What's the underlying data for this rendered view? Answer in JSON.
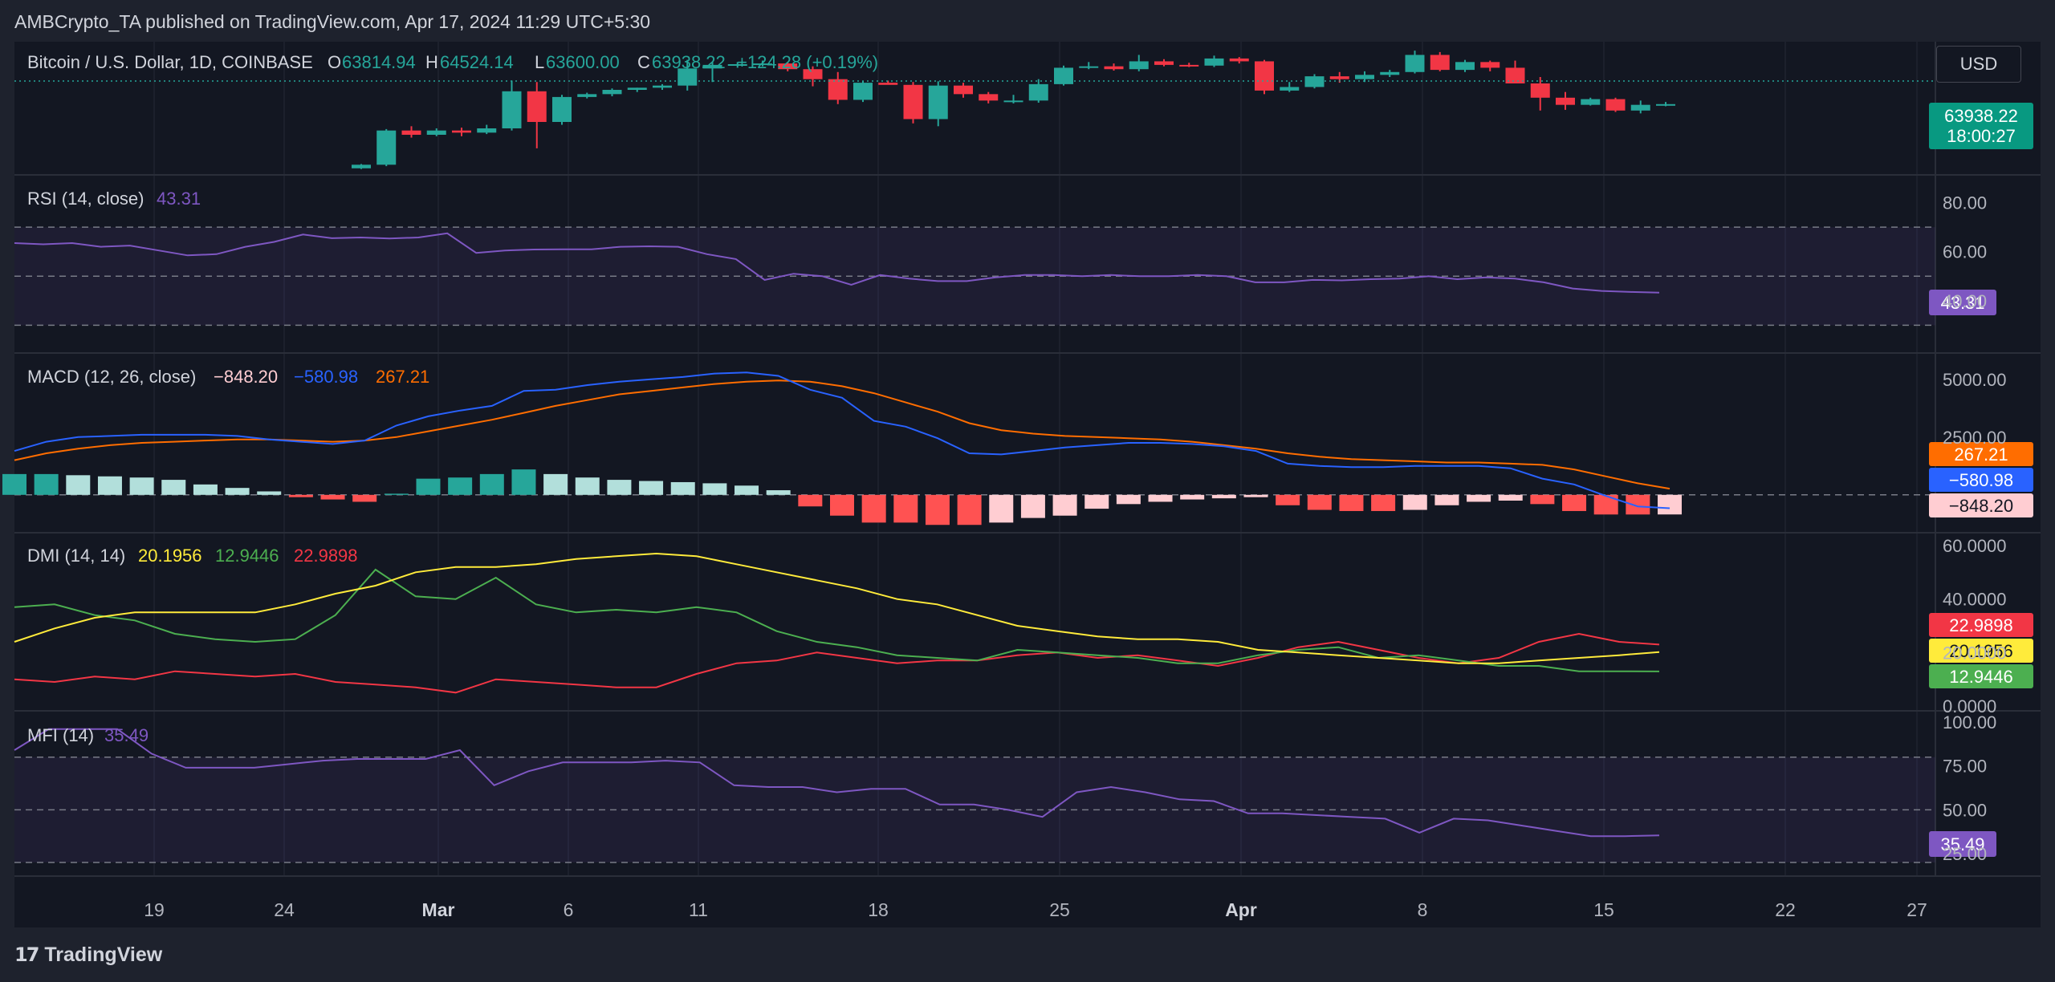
{
  "header": "AMBCrypto_TA published on TradingView.com, Apr 17, 2024 11:29 UTC+5:30",
  "brand": "TradingView",
  "currency": "USD",
  "colors": {
    "bg": "#131722",
    "outer": "#1e222d",
    "up": "#26a69a",
    "down": "#f23645",
    "rsi": "#7e57c2",
    "macd": "#2962ff",
    "signal": "#ff6d00",
    "dmiAdx": "#ffeb3b",
    "dmiPlus": "#4caf50",
    "dmiMinus": "#f23645",
    "mfi": "#7e57c2"
  },
  "chart_data": [
    {
      "type": "candlestick",
      "title": "Bitcoin / U.S. Dollar, 1D, COINBASE",
      "ohlc": {
        "o_label": "O",
        "o": "63814.94",
        "h_label": "H",
        "h": "64524.14",
        "l_label": "L",
        "l": "63600.00",
        "c_label": "C",
        "c": "63938.22",
        "change": "+124.28 (+0.19%)"
      },
      "last_price": "63938.22",
      "countdown": "18:00:27",
      "x_ticks": [
        "19",
        "24",
        "Mar",
        "6",
        "11",
        "18",
        "25",
        "Apr",
        "8",
        "15",
        "22",
        "27"
      ],
      "candles": [
        {
          "o": 51700,
          "h": 52300,
          "l": 51600,
          "c": 52200
        },
        {
          "o": 52200,
          "h": 57200,
          "l": 52000,
          "c": 57000
        },
        {
          "o": 57000,
          "h": 57600,
          "l": 56000,
          "c": 56400
        },
        {
          "o": 56400,
          "h": 57300,
          "l": 56200,
          "c": 57000
        },
        {
          "o": 57000,
          "h": 57400,
          "l": 56200,
          "c": 56700
        },
        {
          "o": 56700,
          "h": 57800,
          "l": 56500,
          "c": 57300
        },
        {
          "o": 57300,
          "h": 64000,
          "l": 57000,
          "c": 62500
        },
        {
          "o": 62500,
          "h": 63800,
          "l": 54500,
          "c": 58200
        },
        {
          "o": 58200,
          "h": 62000,
          "l": 57800,
          "c": 61700
        },
        {
          "o": 61700,
          "h": 62300,
          "l": 61500,
          "c": 62100
        },
        {
          "o": 62100,
          "h": 62900,
          "l": 61800,
          "c": 62700
        },
        {
          "o": 62700,
          "h": 63000,
          "l": 62400,
          "c": 63000
        },
        {
          "o": 63000,
          "h": 63500,
          "l": 62700,
          "c": 63300
        },
        {
          "o": 63300,
          "h": 66900,
          "l": 62600,
          "c": 65700
        },
        {
          "o": 65700,
          "h": 66600,
          "l": 63800,
          "c": 66200
        },
        {
          "o": 66200,
          "h": 66600,
          "l": 65800,
          "c": 66300
        },
        {
          "o": 66300,
          "h": 66800,
          "l": 66000,
          "c": 66400
        },
        {
          "o": 66400,
          "h": 66600,
          "l": 65300,
          "c": 65600
        },
        {
          "o": 65600,
          "h": 66000,
          "l": 63200,
          "c": 64200
        },
        {
          "o": 64200,
          "h": 65200,
          "l": 60700,
          "c": 61300
        },
        {
          "o": 61300,
          "h": 63900,
          "l": 61000,
          "c": 63700
        },
        {
          "o": 63700,
          "h": 64000,
          "l": 63500,
          "c": 63400
        },
        {
          "o": 63400,
          "h": 63800,
          "l": 58000,
          "c": 58600
        },
        {
          "o": 58600,
          "h": 63900,
          "l": 57600,
          "c": 63300
        },
        {
          "o": 63300,
          "h": 63700,
          "l": 61600,
          "c": 62100
        },
        {
          "o": 62100,
          "h": 62400,
          "l": 60800,
          "c": 61200
        },
        {
          "o": 61200,
          "h": 62000,
          "l": 60800,
          "c": 61200
        },
        {
          "o": 61200,
          "h": 64200,
          "l": 60900,
          "c": 63500
        },
        {
          "o": 63500,
          "h": 66100,
          "l": 63300,
          "c": 65800
        },
        {
          "o": 65800,
          "h": 66600,
          "l": 65600,
          "c": 66000
        },
        {
          "o": 66000,
          "h": 66400,
          "l": 65400,
          "c": 65600
        },
        {
          "o": 65600,
          "h": 67600,
          "l": 65300,
          "c": 66700
        },
        {
          "o": 66700,
          "h": 67000,
          "l": 66000,
          "c": 66200
        },
        {
          "o": 66200,
          "h": 66500,
          "l": 65900,
          "c": 66100
        },
        {
          "o": 66100,
          "h": 67500,
          "l": 65900,
          "c": 67100
        },
        {
          "o": 67100,
          "h": 67300,
          "l": 66400,
          "c": 66700
        },
        {
          "o": 66700,
          "h": 66900,
          "l": 62100,
          "c": 62600
        },
        {
          "o": 62600,
          "h": 63800,
          "l": 62400,
          "c": 63100
        },
        {
          "o": 63100,
          "h": 64900,
          "l": 62900,
          "c": 64600
        },
        {
          "o": 64600,
          "h": 65200,
          "l": 63700,
          "c": 64200
        },
        {
          "o": 64200,
          "h": 65300,
          "l": 63800,
          "c": 64800
        },
        {
          "o": 64800,
          "h": 65500,
          "l": 64500,
          "c": 65200
        },
        {
          "o": 65200,
          "h": 68200,
          "l": 65000,
          "c": 67600
        },
        {
          "o": 67600,
          "h": 68000,
          "l": 65300,
          "c": 65500
        },
        {
          "o": 65500,
          "h": 66900,
          "l": 65200,
          "c": 66600
        },
        {
          "o": 66600,
          "h": 66800,
          "l": 65300,
          "c": 65800
        },
        {
          "o": 65800,
          "h": 66800,
          "l": 63700,
          "c": 63600
        },
        {
          "o": 63600,
          "h": 64500,
          "l": 59800,
          "c": 61600
        },
        {
          "o": 61600,
          "h": 62400,
          "l": 59900,
          "c": 60600
        },
        {
          "o": 60600,
          "h": 61600,
          "l": 60500,
          "c": 61400
        },
        {
          "o": 61400,
          "h": 61600,
          "l": 59600,
          "c": 59800
        },
        {
          "o": 59800,
          "h": 61200,
          "l": 59400,
          "c": 60600
        },
        {
          "o": 60600,
          "h": 61000,
          "l": 60400,
          "c": 60700
        }
      ]
    },
    {
      "type": "line",
      "title": "RSI (14, close)",
      "value": "43.31",
      "y_ticks": [
        "80.00",
        "60.00",
        "40.00"
      ],
      "bands": [
        70,
        50,
        30
      ],
      "values": [
        63.5,
        63,
        63.5,
        62,
        62.5,
        60.5,
        58.5,
        59,
        62,
        64,
        67,
        65.5,
        65.8,
        65.4,
        65.8,
        67.5,
        59.5,
        60.5,
        60.9,
        61,
        61,
        62,
        62.2,
        62,
        59,
        57,
        48.5,
        51,
        50,
        46.5,
        50.5,
        49,
        48,
        48,
        49.5,
        50.5,
        50.5,
        50,
        50.5,
        50,
        50,
        50.5,
        50,
        47.5,
        47.5,
        48.5,
        48.3,
        48.8,
        49,
        50,
        48.8,
        49.5,
        49,
        47.5,
        45,
        44,
        43.6,
        43.31
      ]
    },
    {
      "type": "line+histogram",
      "title": "MACD (12, 26, close)",
      "hist_value": "−848.20",
      "macd_value": "−580.98",
      "signal_value": "267.21",
      "y_ticks": [
        "5000.00",
        "2500.00"
      ],
      "macd": [
        1900,
        2300,
        2500,
        2550,
        2600,
        2600,
        2600,
        2550,
        2400,
        2300,
        2200,
        2350,
        3000,
        3400,
        3650,
        3850,
        4500,
        4550,
        4750,
        4900,
        5000,
        5100,
        5250,
        5300,
        5150,
        4550,
        4200,
        3200,
        2950,
        2450,
        1800,
        1750,
        1900,
        2050,
        2150,
        2250,
        2250,
        2200,
        2100,
        1900,
        1350,
        1250,
        1200,
        1200,
        1250,
        1250,
        1250,
        1150,
        700,
        450,
        -50,
        -500,
        -580.98
      ],
      "signal": [
        1500,
        1800,
        2000,
        2150,
        2250,
        2300,
        2350,
        2400,
        2400,
        2350,
        2300,
        2350,
        2500,
        2750,
        3000,
        3250,
        3550,
        3850,
        4100,
        4350,
        4500,
        4650,
        4800,
        4900,
        4950,
        4900,
        4700,
        4400,
        4000,
        3600,
        3100,
        2800,
        2650,
        2550,
        2500,
        2450,
        2400,
        2300,
        2150,
        2000,
        1800,
        1650,
        1550,
        1500,
        1450,
        1400,
        1400,
        1350,
        1300,
        1100,
        800,
        500,
        267.21
      ],
      "hist": [
        900,
        900,
        850,
        800,
        750,
        650,
        450,
        300,
        150,
        -100,
        -200,
        -300,
        50,
        700,
        750,
        900,
        1100,
        900,
        750,
        650,
        600,
        550,
        500,
        400,
        200,
        -500,
        -900,
        -1200,
        -1200,
        -1300,
        -1300,
        -1200,
        -1000,
        -900,
        -600,
        -400,
        -300,
        -200,
        -150,
        -100,
        -450,
        -650,
        -700,
        -700,
        -650,
        -450,
        -300,
        -250,
        -400,
        -700,
        -850,
        -850,
        -848.2
      ]
    },
    {
      "type": "line",
      "title": "DMI (14, 14)",
      "adx_value": "20.1956",
      "plus_value": "12.9446",
      "minus_value": "22.9898",
      "y_ticks": [
        "60.0000",
        "40.0000",
        "20.0000",
        "0.0000"
      ],
      "adx": [
        24,
        29,
        33,
        35,
        35,
        35,
        35,
        38,
        42,
        45,
        50,
        52,
        52,
        53,
        55,
        56,
        57,
        56,
        53,
        50,
        47,
        44,
        40,
        38,
        34,
        30,
        28,
        26,
        25,
        25,
        24,
        21,
        20,
        19,
        18,
        17,
        16,
        16,
        17,
        18,
        19,
        20.1956
      ],
      "plus_di": [
        37,
        38,
        34,
        32,
        27,
        25,
        24,
        25,
        34,
        51,
        41,
        40,
        48,
        38,
        35,
        36,
        35,
        37,
        35,
        28,
        24,
        22,
        19,
        18,
        17,
        21,
        20,
        19,
        18,
        16,
        16,
        19,
        21,
        22,
        18,
        19,
        17,
        15,
        15,
        13,
        13,
        12.9446
      ],
      "minus_di": [
        10,
        9,
        11,
        10,
        13,
        12,
        11,
        12,
        9,
        8,
        7,
        5,
        10,
        9,
        8,
        7,
        7,
        12,
        16,
        17,
        20,
        18,
        16,
        17,
        17,
        19,
        20,
        18,
        19,
        17,
        15,
        18,
        22,
        24,
        21,
        18,
        16,
        18,
        24,
        27,
        24,
        22.9898
      ]
    },
    {
      "type": "line",
      "title": "MFI (14)",
      "value": "35.49",
      "y_ticks": [
        "100.00",
        "75.00",
        "50.00",
        "25.00"
      ],
      "bands": [
        80,
        50,
        20
      ],
      "values": [
        84,
        96,
        96,
        96,
        82,
        74,
        74,
        74,
        76,
        78,
        79,
        79,
        79,
        84,
        64,
        72,
        77,
        77,
        77,
        78,
        77,
        64,
        63,
        63,
        60,
        62,
        62,
        53,
        53,
        50,
        46,
        60,
        63,
        60,
        56,
        55,
        48,
        48,
        47,
        46,
        45,
        37,
        45,
        44,
        41,
        38,
        35,
        35,
        35.49
      ]
    }
  ]
}
